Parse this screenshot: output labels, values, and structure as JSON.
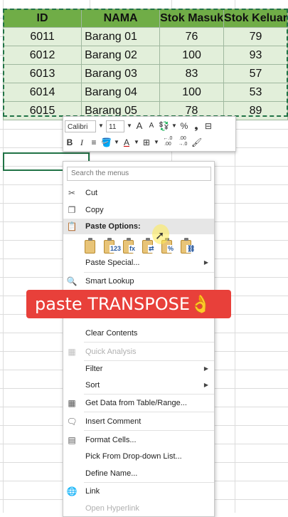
{
  "table": {
    "headers": [
      "ID",
      "NAMA",
      "Stok Masuk",
      "Stok Keluar"
    ],
    "rows": [
      [
        "6011",
        "Barang 01",
        "76",
        "79"
      ],
      [
        "6012",
        "Barang 02",
        "100",
        "93"
      ],
      [
        "6013",
        "Barang 03",
        "83",
        "57"
      ],
      [
        "6014",
        "Barang 04",
        "100",
        "53"
      ],
      [
        "6015",
        "Barang 05",
        "78",
        "89"
      ]
    ]
  },
  "mini_toolbar": {
    "font_name": "Calibri",
    "font_size": "11",
    "grow_font": "A",
    "shrink_font": "A",
    "percent": "%",
    "comma": "❟",
    "bold": "B",
    "italic": "I",
    "align": "≡",
    "font_color": "A",
    "inc_decimal": "←.0 .00",
    "dec_decimal": ".00 →.0"
  },
  "context_menu": {
    "search_placeholder": "Search the menus",
    "items": {
      "cut": "Cut",
      "copy": "Copy",
      "paste_options": "Paste Options:",
      "paste_special": "Paste Special...",
      "smart_lookup": "Smart Lookup",
      "clear_contents": "Clear Contents",
      "quick_analysis": "Quick Analysis",
      "filter": "Filter",
      "sort": "Sort",
      "get_data": "Get Data from Table/Range...",
      "insert_comment": "Insert Comment",
      "format_cells": "Format Cells...",
      "pick_list": "Pick From Drop-down List...",
      "define_name": "Define Name...",
      "link": "Link",
      "open_hyperlink": "Open Hyperlink"
    },
    "paste_icon_overlays": [
      "",
      "123",
      "fx",
      "⇄",
      "%",
      "⛓"
    ]
  },
  "banner": {
    "text": "paste TRANSPOSE👌"
  },
  "colors": {
    "header_green": "#70ad47",
    "cell_green": "#e2efda",
    "banner_red": "#e8403a"
  }
}
